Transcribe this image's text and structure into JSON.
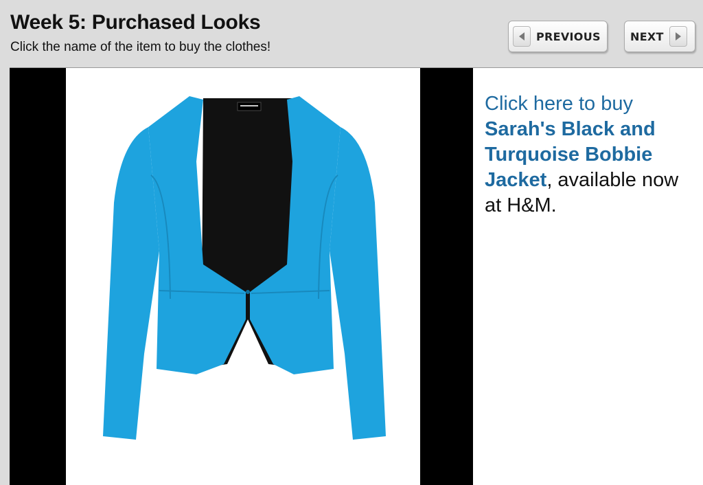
{
  "header": {
    "title": "Week 5: Purchased Looks",
    "subtitle": "Click the name of the item to buy the clothes!"
  },
  "nav": {
    "previous_label": "PREVIOUS",
    "next_label": "NEXT"
  },
  "product": {
    "lead_text": "Click here to buy",
    "item_name": "Sarah's Black and Turquoise Bobbie Jacket",
    "suffix_text": ", available now at H&M."
  },
  "icons": {
    "previous": "chevron-left-icon",
    "next": "chevron-right-icon"
  },
  "colors": {
    "link": "#1e6aa0",
    "jacket": "#1ea3de",
    "background": "#dcdcdc"
  }
}
